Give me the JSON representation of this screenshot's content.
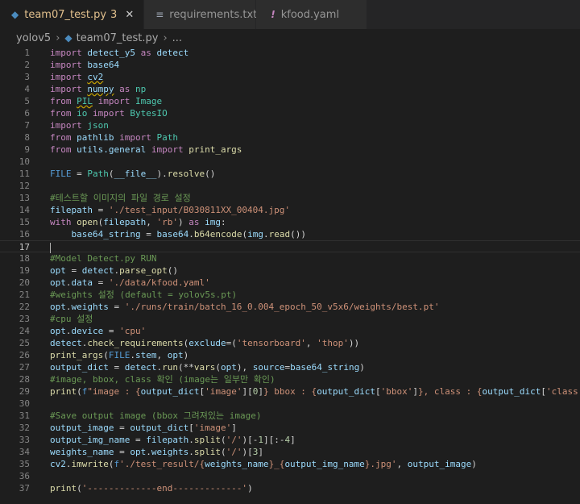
{
  "tabs": [
    {
      "label": "team07_test.py",
      "badge": "3",
      "icon": "python-icon",
      "active": true
    },
    {
      "label": "requirements.txt",
      "icon": "list-icon",
      "active": false
    },
    {
      "label": "kfood.yaml",
      "icon": "yaml-exclamation-icon",
      "active": false
    }
  ],
  "tab_close_glyph": "✕",
  "breadcrumb": {
    "folder": "yolov5",
    "file": "team07_test.py",
    "more": "..."
  },
  "current_line": 17,
  "lines": [
    {
      "n": "1",
      "t": [
        [
          "import ",
          "k"
        ],
        [
          "detect_y5 ",
          "v"
        ],
        [
          "as ",
          "k"
        ],
        [
          "detect",
          "v"
        ]
      ]
    },
    {
      "n": "2",
      "t": [
        [
          "import ",
          "k"
        ],
        [
          "base64",
          "v"
        ]
      ]
    },
    {
      "n": "3",
      "t": [
        [
          "import ",
          "k"
        ],
        [
          "cv2",
          "v sq"
        ]
      ]
    },
    {
      "n": "4",
      "t": [
        [
          "import ",
          "k"
        ],
        [
          "numpy",
          "v sq"
        ],
        [
          " as ",
          "k"
        ],
        [
          "np",
          "t"
        ]
      ]
    },
    {
      "n": "5",
      "t": [
        [
          "from ",
          "k"
        ],
        [
          "PIL",
          "t sq"
        ],
        [
          " import ",
          "k"
        ],
        [
          "Image",
          "t"
        ]
      ]
    },
    {
      "n": "6",
      "t": [
        [
          "from ",
          "k"
        ],
        [
          "io ",
          "t"
        ],
        [
          "import ",
          "k"
        ],
        [
          "BytesIO",
          "t"
        ]
      ]
    },
    {
      "n": "7",
      "t": [
        [
          "import ",
          "k"
        ],
        [
          "json",
          "t"
        ]
      ]
    },
    {
      "n": "8",
      "t": [
        [
          "from ",
          "k"
        ],
        [
          "pathlib ",
          "v"
        ],
        [
          "import ",
          "k"
        ],
        [
          "Path",
          "t"
        ]
      ]
    },
    {
      "n": "9",
      "t": [
        [
          "from ",
          "k"
        ],
        [
          "utils.general ",
          "v"
        ],
        [
          "import ",
          "k"
        ],
        [
          "print_args",
          "f"
        ]
      ]
    },
    {
      "n": "10",
      "t": []
    },
    {
      "n": "11",
      "t": [
        [
          "FILE",
          "b"
        ],
        [
          " = ",
          "p"
        ],
        [
          "Path",
          "t"
        ],
        [
          "(",
          "p"
        ],
        [
          "__file__",
          "v"
        ],
        [
          ").",
          "p"
        ],
        [
          "resolve",
          "f"
        ],
        [
          "()",
          "p"
        ]
      ]
    },
    {
      "n": "12",
      "t": []
    },
    {
      "n": "13",
      "t": [
        [
          "#테스트할 이미지의 파일 경로 설정",
          "c"
        ]
      ]
    },
    {
      "n": "14",
      "t": [
        [
          "filepath",
          "v"
        ],
        [
          " = ",
          "p"
        ],
        [
          "'./test_input/B030811XX_00404.jpg'",
          "s"
        ]
      ]
    },
    {
      "n": "15",
      "t": [
        [
          "with ",
          "k"
        ],
        [
          "open",
          "f"
        ],
        [
          "(",
          "p"
        ],
        [
          "filepath",
          "v"
        ],
        [
          ", ",
          "p"
        ],
        [
          "'rb'",
          "s"
        ],
        [
          ") ",
          "p"
        ],
        [
          "as ",
          "k"
        ],
        [
          "img",
          "v"
        ],
        [
          ":",
          "p"
        ]
      ]
    },
    {
      "n": "16",
      "t": [
        [
          "    base64_string",
          "v"
        ],
        [
          " = ",
          "p"
        ],
        [
          "base64",
          "v"
        ],
        [
          ".",
          "p"
        ],
        [
          "b64encode",
          "f"
        ],
        [
          "(",
          "p"
        ],
        [
          "img",
          "v"
        ],
        [
          ".",
          "p"
        ],
        [
          "read",
          "f"
        ],
        [
          "())",
          "p"
        ]
      ]
    },
    {
      "n": "17",
      "t": []
    },
    {
      "n": "18",
      "t": [
        [
          "#Model Detect.py RUN",
          "c"
        ]
      ]
    },
    {
      "n": "19",
      "t": [
        [
          "opt",
          "v"
        ],
        [
          " = ",
          "p"
        ],
        [
          "detect",
          "v"
        ],
        [
          ".",
          "p"
        ],
        [
          "parse_opt",
          "f"
        ],
        [
          "()",
          "p"
        ]
      ]
    },
    {
      "n": "20",
      "t": [
        [
          "opt",
          "v"
        ],
        [
          ".",
          "p"
        ],
        [
          "data",
          "v"
        ],
        [
          " = ",
          "p"
        ],
        [
          "'./data/kfood.yaml'",
          "s"
        ]
      ]
    },
    {
      "n": "21",
      "t": [
        [
          "#weights 설정 (default = yolov5s.pt)",
          "c"
        ]
      ]
    },
    {
      "n": "22",
      "t": [
        [
          "opt",
          "v"
        ],
        [
          ".",
          "p"
        ],
        [
          "weights",
          "v"
        ],
        [
          " = ",
          "p"
        ],
        [
          "'./runs/train/batch_16_0.004_epoch_50_v5x6/weights/best.pt'",
          "s"
        ]
      ]
    },
    {
      "n": "23",
      "t": [
        [
          "#cpu 설정",
          "c"
        ]
      ]
    },
    {
      "n": "24",
      "t": [
        [
          "opt",
          "v"
        ],
        [
          ".",
          "p"
        ],
        [
          "device",
          "v"
        ],
        [
          " = ",
          "p"
        ],
        [
          "'cpu'",
          "s"
        ]
      ]
    },
    {
      "n": "25",
      "t": [
        [
          "detect",
          "v"
        ],
        [
          ".",
          "p"
        ],
        [
          "check_requirements",
          "f"
        ],
        [
          "(",
          "p"
        ],
        [
          "exclude",
          "v"
        ],
        [
          "=(",
          "p"
        ],
        [
          "'tensorboard'",
          "s"
        ],
        [
          ", ",
          "p"
        ],
        [
          "'thop'",
          "s"
        ],
        [
          "))",
          "p"
        ]
      ]
    },
    {
      "n": "26",
      "t": [
        [
          "print_args",
          "f"
        ],
        [
          "(",
          "p"
        ],
        [
          "FILE",
          "b"
        ],
        [
          ".",
          "p"
        ],
        [
          "stem",
          "v"
        ],
        [
          ", ",
          "p"
        ],
        [
          "opt",
          "v"
        ],
        [
          ")",
          "p"
        ]
      ]
    },
    {
      "n": "27",
      "t": [
        [
          "output_dict",
          "v"
        ],
        [
          " = ",
          "p"
        ],
        [
          "detect",
          "v"
        ],
        [
          ".",
          "p"
        ],
        [
          "run",
          "f"
        ],
        [
          "(**",
          "p"
        ],
        [
          "vars",
          "f"
        ],
        [
          "(",
          "p"
        ],
        [
          "opt",
          "v"
        ],
        [
          "), ",
          "p"
        ],
        [
          "source",
          "v"
        ],
        [
          "=",
          "p"
        ],
        [
          "base64_string",
          "v"
        ],
        [
          ")",
          "p"
        ]
      ]
    },
    {
      "n": "28",
      "t": [
        [
          "#image, bbox, class 확인 (image는 일부만 확인)",
          "c"
        ]
      ]
    },
    {
      "n": "29",
      "t": [
        [
          "print",
          "f"
        ],
        [
          "(",
          "p"
        ],
        [
          "f",
          "b"
        ],
        [
          "\"image : {",
          "s"
        ],
        [
          "output_dict",
          "v"
        ],
        [
          "[",
          "p"
        ],
        [
          "'image'",
          "s"
        ],
        [
          "][",
          "p"
        ],
        [
          "0",
          "n"
        ],
        [
          "]",
          "p"
        ],
        [
          "} bbox : {",
          "s"
        ],
        [
          "output_dict",
          "v"
        ],
        [
          "[",
          "p"
        ],
        [
          "'bbox'",
          "s"
        ],
        [
          "]",
          "p"
        ],
        [
          "}, class : {",
          "s"
        ],
        [
          "output_dict",
          "v"
        ],
        [
          "[",
          "p"
        ],
        [
          "'class'",
          "s"
        ],
        [
          "]",
          "p"
        ],
        [
          "}\"",
          "s"
        ],
        [
          ")",
          "p"
        ]
      ]
    },
    {
      "n": "30",
      "t": []
    },
    {
      "n": "31",
      "t": [
        [
          "#Save output image (bbox 그려져있는 image)",
          "c"
        ]
      ]
    },
    {
      "n": "32",
      "t": [
        [
          "output_image",
          "v"
        ],
        [
          " = ",
          "p"
        ],
        [
          "output_dict",
          "v"
        ],
        [
          "[",
          "p"
        ],
        [
          "'image'",
          "s"
        ],
        [
          "]",
          "p"
        ]
      ]
    },
    {
      "n": "33",
      "t": [
        [
          "output_img_name",
          "v"
        ],
        [
          " = ",
          "p"
        ],
        [
          "filepath",
          "v"
        ],
        [
          ".",
          "p"
        ],
        [
          "split",
          "f"
        ],
        [
          "(",
          "p"
        ],
        [
          "'/'",
          "s"
        ],
        [
          ")[-",
          "p"
        ],
        [
          "1",
          "n"
        ],
        [
          "][:-",
          "p"
        ],
        [
          "4",
          "n"
        ],
        [
          "]",
          "p"
        ]
      ]
    },
    {
      "n": "34",
      "t": [
        [
          "weights_name",
          "v"
        ],
        [
          " = ",
          "p"
        ],
        [
          "opt",
          "v"
        ],
        [
          ".",
          "p"
        ],
        [
          "weights",
          "v"
        ],
        [
          ".",
          "p"
        ],
        [
          "split",
          "f"
        ],
        [
          "(",
          "p"
        ],
        [
          "'/'",
          "s"
        ],
        [
          ")[",
          "p"
        ],
        [
          "3",
          "n"
        ],
        [
          "]",
          "p"
        ]
      ]
    },
    {
      "n": "35",
      "t": [
        [
          "cv2",
          "v"
        ],
        [
          ".",
          "p"
        ],
        [
          "imwrite",
          "f"
        ],
        [
          "(",
          "p"
        ],
        [
          "f",
          "b"
        ],
        [
          "'./test_result/{",
          "s"
        ],
        [
          "weights_name",
          "v"
        ],
        [
          "}_{",
          "s"
        ],
        [
          "output_img_name",
          "v"
        ],
        [
          "}.jpg'",
          "s"
        ],
        [
          ", ",
          "p"
        ],
        [
          "output_image",
          "v"
        ],
        [
          ")",
          "p"
        ]
      ]
    },
    {
      "n": "36",
      "t": []
    },
    {
      "n": "37",
      "t": [
        [
          "print",
          "f"
        ],
        [
          "(",
          "p"
        ],
        [
          "'-------------end-------------'",
          "s"
        ],
        [
          ")",
          "p"
        ]
      ]
    }
  ]
}
